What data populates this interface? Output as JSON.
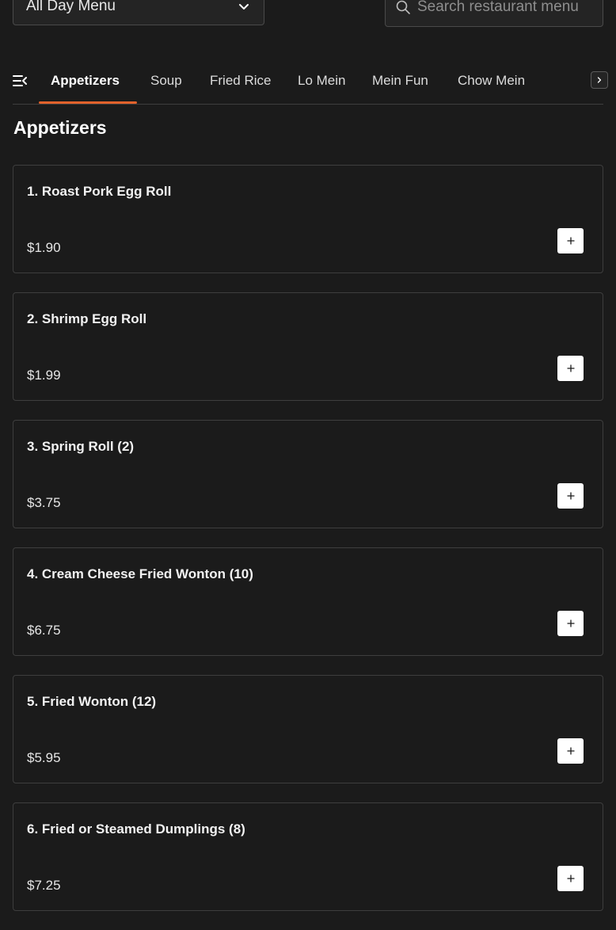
{
  "menu_select": {
    "value": "All Day Menu",
    "icon": "chevron-down-icon"
  },
  "search": {
    "placeholder": "Search restaurant menu",
    "icon": "search-icon"
  },
  "tabs": [
    {
      "label": "Appetizers",
      "active": true
    },
    {
      "label": "Soup"
    },
    {
      "label": "Fried Rice"
    },
    {
      "label": "Lo Mein"
    },
    {
      "label": "Mein Fun"
    },
    {
      "label": "Chow Mein"
    }
  ],
  "section": {
    "title": "Appetizers"
  },
  "items": [
    {
      "name": "1. Roast Pork Egg Roll",
      "price": "$1.90"
    },
    {
      "name": "2. Shrimp Egg Roll",
      "price": "$1.99"
    },
    {
      "name": "3. Spring Roll (2)",
      "price": "$3.75"
    },
    {
      "name": "4. Cream Cheese Fried Wonton (10)",
      "price": "$6.75"
    },
    {
      "name": "5. Fried Wonton (12)",
      "price": "$5.95"
    },
    {
      "name": "6. Fried or Steamed Dumplings (8)",
      "price": "$7.25"
    }
  ],
  "colors": {
    "background": "#1b1b1b",
    "accent": "#e2622b",
    "border": "#3e3e3e"
  }
}
